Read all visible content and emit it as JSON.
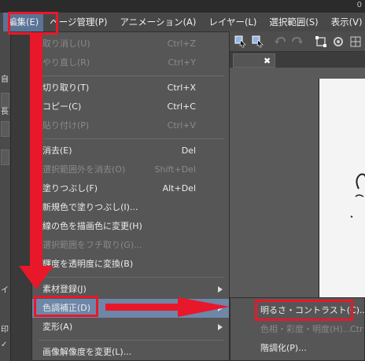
{
  "titlebar": {
    "num": "0"
  },
  "menubar": {
    "items": [
      {
        "label": "編集(E)",
        "active": true
      },
      {
        "label": "ページ管理(P)"
      },
      {
        "label": "アニメーション(A)"
      },
      {
        "label": "レイヤー(L)"
      },
      {
        "label": "選択範囲(S)"
      },
      {
        "label": "表示(V)"
      }
    ]
  },
  "leftstrip": {
    "chars": [
      "自",
      "長",
      "イ",
      "印",
      "✓"
    ]
  },
  "edit_menu": {
    "items": [
      {
        "label": "取り消し(U)",
        "shortcut": "Ctrl+Z",
        "disabled": true
      },
      {
        "label": "やり直し(R)",
        "shortcut": "Ctrl+Y",
        "disabled": true
      },
      {
        "label": "切り取り(T)",
        "shortcut": "Ctrl+X"
      },
      {
        "label": "コピー(C)",
        "shortcut": "Ctrl+C"
      },
      {
        "label": "貼り付け(P)",
        "shortcut": "Ctrl+V",
        "disabled": true
      },
      {
        "label": "消去(E)",
        "shortcut": "Del"
      },
      {
        "label": "選択範囲外を消去(O)",
        "shortcut": "Shift+Del",
        "disabled": true
      },
      {
        "label": "塗りつぶし(F)",
        "shortcut": "Alt+Del"
      },
      {
        "label": "新規色で塗りつぶし(I)..."
      },
      {
        "label": "線の色を描画色に変更(H)"
      },
      {
        "label": "選択範囲をフチ取り(G)...",
        "disabled": true
      },
      {
        "label": "輝度を透明度に変換(B)"
      },
      {
        "label": "素材登録(J)",
        "submenu": true
      },
      {
        "label": "色調補正(D)",
        "submenu": true,
        "highlighted": true
      },
      {
        "label": "変形(A)",
        "submenu": true
      },
      {
        "label": "画像解像度を変更(L)..."
      }
    ]
  },
  "adjust_submenu": {
    "items": [
      {
        "label": "明るさ・コントラスト(C)...",
        "highlighted": true
      },
      {
        "label": "色相・彩度・明度(H)...",
        "shortcut": "Ctr",
        "disabled": true
      },
      {
        "label": "階調化(P)..."
      }
    ]
  },
  "colors": {
    "annotation": "#e8182a",
    "highlight": "#6e86a8",
    "menu_bg": "#565656"
  }
}
